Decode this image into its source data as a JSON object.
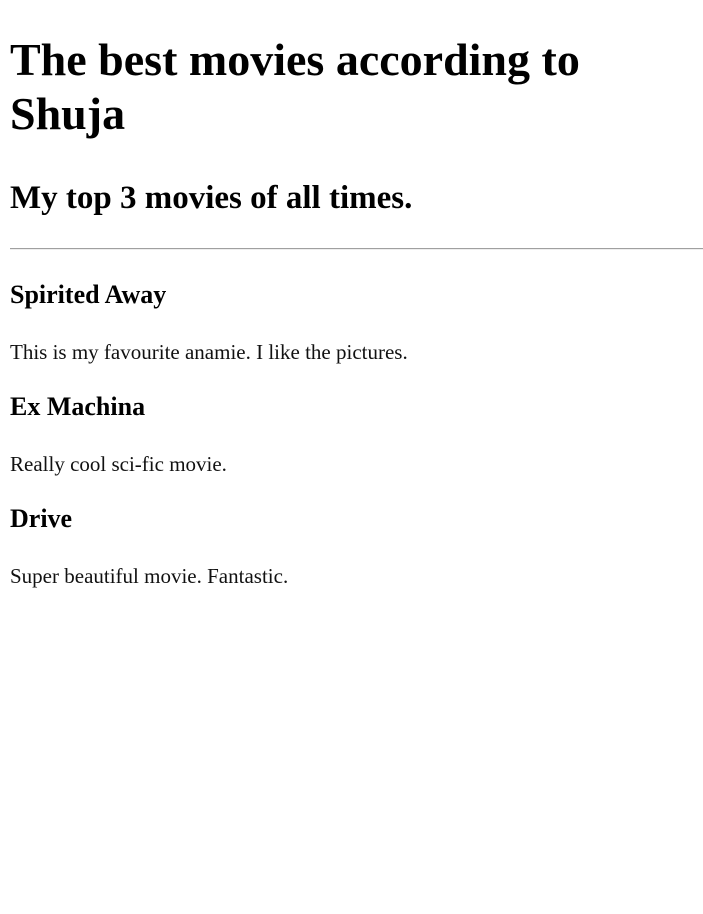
{
  "page": {
    "title": "The best movies according to Shuja",
    "subtitle": "My top 3 movies of all times."
  },
  "movies": [
    {
      "title": "Spirited Away",
      "description": "This is my favourite anamie. I like the pictures."
    },
    {
      "title": "Ex Machina",
      "description": "Really cool sci-fic movie."
    },
    {
      "title": "Drive",
      "description": "Super beautiful movie. Fantastic."
    }
  ]
}
